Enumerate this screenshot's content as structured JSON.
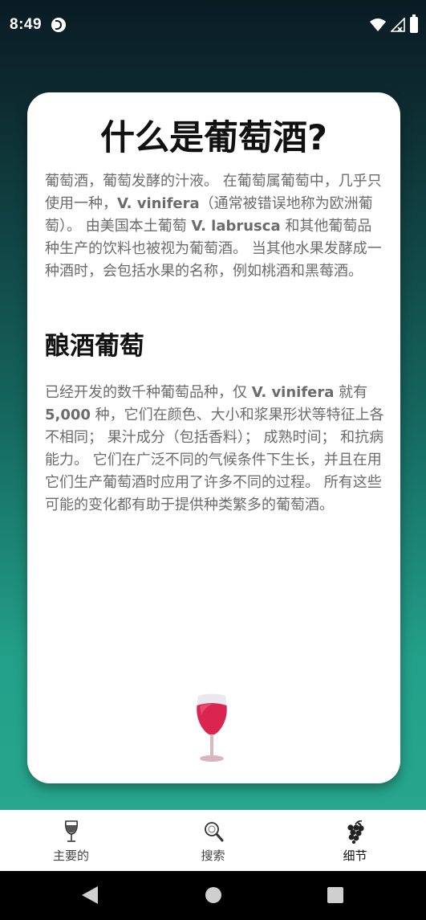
{
  "status_bar": {
    "time": "8:49",
    "app_icon": "app-notification-icon",
    "icons": [
      "wifi-icon",
      "signal-icon",
      "battery-icon"
    ]
  },
  "card": {
    "title": "什么是葡萄酒?",
    "intro_paragraph": {
      "t1": "葡萄酒，葡萄发酵的汁液。 在葡萄属葡萄中，几乎只使用一种，",
      "b1": "V. vinifera",
      "t2": "（通常被错误地称为欧洲葡萄）。 由美国本土葡萄 ",
      "b2": "V. labrusca",
      "t3": " 和其他葡萄品种生产的饮料也被视为葡萄酒。 当其他水果发酵成一种酒时，会包括水果的名称，例如桃酒和黑莓酒。"
    },
    "section_heading": "酿酒葡萄",
    "section_paragraph": {
      "t1": "已经开发的数千种葡萄品种，仅 ",
      "b1": "V. vinifera",
      "t2": " 就有 ",
      "b2": "5,000",
      "t3": " 种，它们在颜色、大小和浆果形状等特征上各不相同； 果汁成分（包括香料）； 成熟时间； 和抗病能力。 它们在广泛不同的气候条件下生长，并且在用它们生产葡萄酒时应用了许多不同的过程。 所有这些可能的变化都有助于提供种类繁多的葡萄酒。"
    },
    "illustration": "wine-glass-icon"
  },
  "bottom_nav": {
    "items": [
      {
        "label": "主要的",
        "icon": "wine-glass-outline-icon",
        "active": false
      },
      {
        "label": "搜索",
        "icon": "magnifier-icon",
        "active": false
      },
      {
        "label": "细节",
        "icon": "grapes-icon",
        "active": true
      }
    ]
  },
  "system_nav": [
    "back-icon",
    "home-icon",
    "recents-icon"
  ],
  "colors": {
    "gradient_top": "#0a1b24",
    "gradient_bottom": "#27a68d",
    "wine_red": "#d9254f",
    "body_text": "#6b6b6b"
  }
}
